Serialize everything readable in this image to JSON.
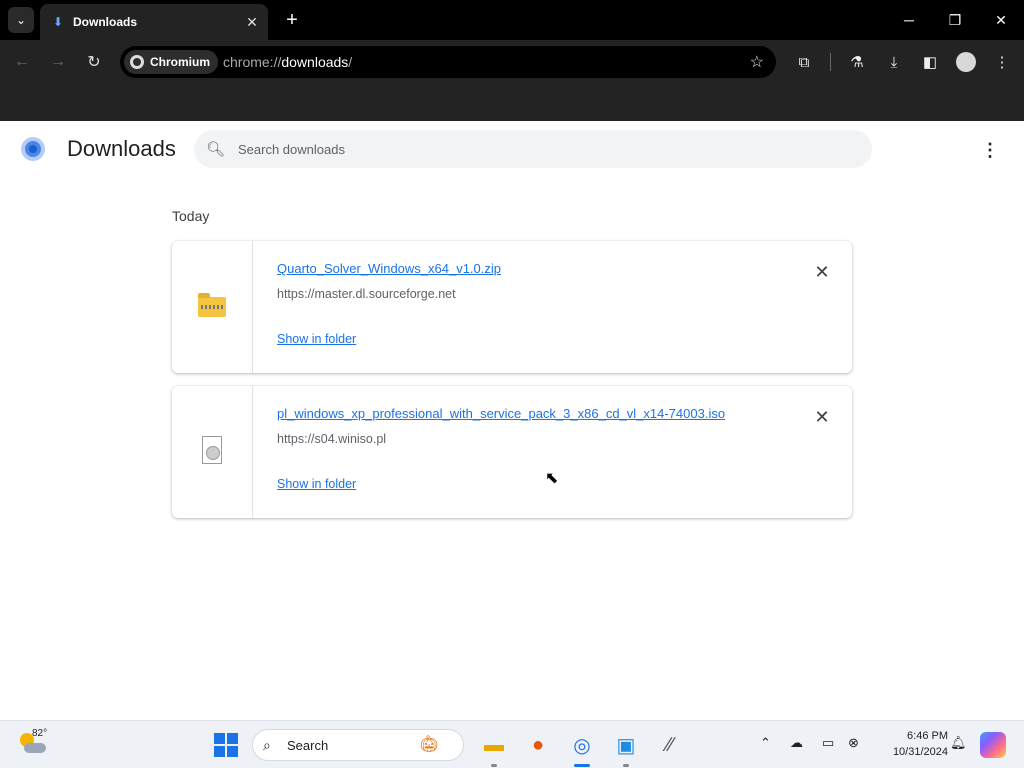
{
  "browser": {
    "tab": {
      "title": "Downloads"
    },
    "omnibox": {
      "chip": "Chromium",
      "url_scheme": "chrome://",
      "url_host": "downloads",
      "url_path": "/"
    }
  },
  "page": {
    "title": "Downloads",
    "search": {
      "placeholder": "Search downloads"
    },
    "date_header": "Today",
    "downloads": [
      {
        "file_name": "Quarto_Solver_Windows_x64_v1.0.zip",
        "source": "https://master.dl.sourceforge.net",
        "action": "Show in folder",
        "icon": "zip-folder-icon"
      },
      {
        "file_name": "pl_windows_xp_professional_with_service_pack_3_x86_cd_vl_x14-74003.iso",
        "source": "https://s04.winiso.pl",
        "action": "Show in folder",
        "icon": "disc-image-icon"
      }
    ]
  },
  "taskbar": {
    "weather": {
      "temp": "82°"
    },
    "search": {
      "label": "Search"
    },
    "clock": {
      "time": "6:46 PM",
      "date": "10/31/2024"
    }
  },
  "colors": {
    "link": "#1a73e8",
    "browser_chrome": "#232323",
    "tab_strip": "#000000"
  }
}
